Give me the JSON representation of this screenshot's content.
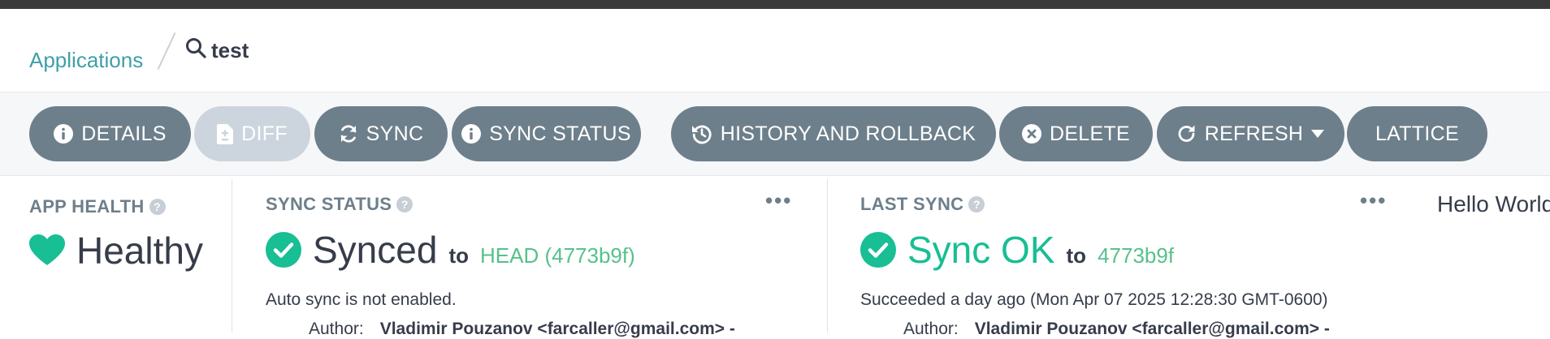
{
  "breadcrumb": {
    "root_label": "Applications",
    "search_text": "test"
  },
  "toolbar": {
    "buttons": [
      {
        "label": "DETAILS",
        "icon": "info-icon",
        "disabled": false
      },
      {
        "label": "DIFF",
        "icon": "file-diff-icon",
        "disabled": true
      },
      {
        "label": "SYNC",
        "icon": "sync-icon",
        "disabled": false
      },
      {
        "label": "SYNC STATUS",
        "icon": "info-icon",
        "disabled": false
      },
      {
        "label": "HISTORY AND ROLLBACK",
        "icon": "history-icon",
        "disabled": false
      },
      {
        "label": "DELETE",
        "icon": "close-circle-icon",
        "disabled": false
      },
      {
        "label": "REFRESH",
        "icon": "refresh-icon",
        "disabled": false
      },
      {
        "label": "LATTICE",
        "icon": "",
        "disabled": false
      }
    ]
  },
  "app_health": {
    "title": "APP HEALTH",
    "status": "Healthy",
    "color": "#18be94"
  },
  "sync_status": {
    "title": "SYNC STATUS",
    "status": "Synced",
    "to_word": "to",
    "revision": "HEAD (4773b9f)",
    "detail": "Auto sync is not enabled.",
    "author_label": "Author:",
    "author_value": "Vladimir Pouzanov <farcaller@gmail.com> -",
    "color": "#18be94"
  },
  "last_sync": {
    "title": "LAST SYNC",
    "status": "Sync OK",
    "to_word": "to",
    "revision": "4773b9f",
    "detail": "Succeeded a day ago (Mon Apr 07 2025 12:28:30 GMT-0600)",
    "author_label": "Author:",
    "author_value": "Vladimir Pouzanov <farcaller@gmail.com> -",
    "color": "#18be94"
  },
  "extra": {
    "hello_text": "Hello World"
  },
  "help_glyph": "?",
  "more_glyph": "•••"
}
